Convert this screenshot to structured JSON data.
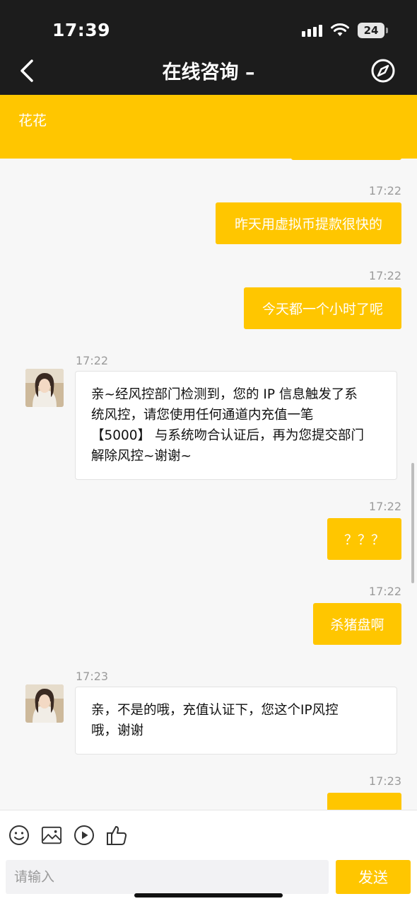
{
  "status": {
    "time": "17:39",
    "battery": "24"
  },
  "nav": {
    "title": "在线咨询 –"
  },
  "banner": {
    "name": "花花"
  },
  "messages": [
    {
      "side": "out",
      "time": "17:22",
      "text": "昨天用虚拟币提款很快的"
    },
    {
      "side": "out",
      "time": "17:22",
      "text": "今天都一个小时了呢"
    },
    {
      "side": "in",
      "time": "17:22",
      "lines": [
        "亲~经风控部门检测到，您的 IP 信息触发了系",
        "统风控，请您使用任何通道内充值一笔",
        "【5000】 与系统吻合认证后，再为您提交部门",
        "解除风控~谢谢~"
      ]
    },
    {
      "side": "out",
      "time": "17:22",
      "text": "？？？"
    },
    {
      "side": "out",
      "time": "17:22",
      "text": "杀猪盘啊"
    },
    {
      "side": "in",
      "time": "17:23",
      "lines": [
        "亲，不是的哦，充值认证下，您这个IP风控",
        "哦，谢谢"
      ]
    },
    {
      "side": "out",
      "time": "17:23",
      "text": ""
    }
  ],
  "toolbar": {
    "icons": [
      "emoji-icon",
      "image-icon",
      "video-icon",
      "thumbs-up-icon"
    ],
    "input_placeholder": "请输入",
    "send_label": "发送"
  },
  "colors": {
    "accent": "#ffc600",
    "dark": "#1c1c1c"
  }
}
